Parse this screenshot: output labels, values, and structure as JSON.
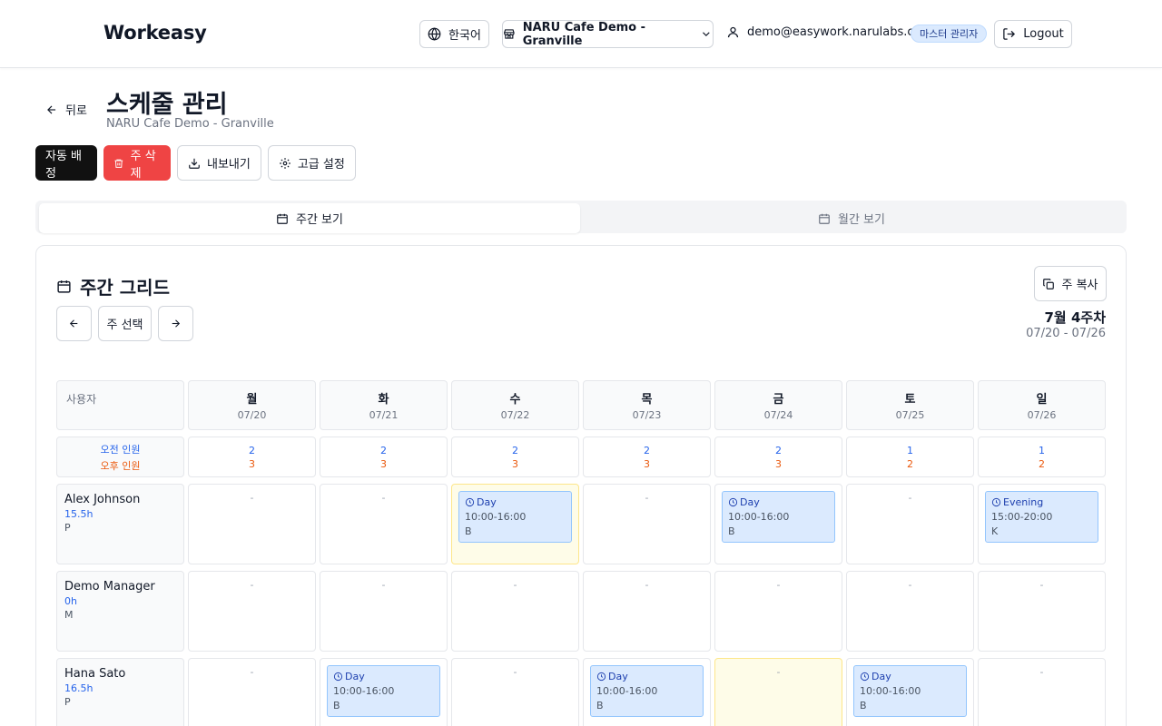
{
  "header": {
    "brand": "Workeasy",
    "language": "한국어",
    "store": "NARU Cafe Demo - Granville",
    "email": "demo@easywork.narulabs.ca",
    "role_badge": "마스터 관리자",
    "logout": "Logout"
  },
  "page": {
    "back": "뒤로",
    "title": "스케줄 관리",
    "subtitle": "NARU Cafe Demo - Granville"
  },
  "actions": {
    "auto_assign": "자동 배정",
    "delete_week": "주 삭제",
    "export": "내보내기",
    "advanced": "고급 설정"
  },
  "tabs": {
    "weekly": "주간 보기",
    "monthly": "월간 보기"
  },
  "card": {
    "title": "주간 그리드",
    "copy_week": "주 복사",
    "select_week": "주 선택",
    "week_label": "7월 4주차",
    "week_range": "07/20 - 07/26"
  },
  "grid": {
    "user_header": "사용자",
    "am_label": "오전 인원",
    "pm_label": "오후 인원",
    "days": [
      {
        "name": "월",
        "date": "07/20",
        "am": "2",
        "pm": "3"
      },
      {
        "name": "화",
        "date": "07/21",
        "am": "2",
        "pm": "3"
      },
      {
        "name": "수",
        "date": "07/22",
        "am": "2",
        "pm": "3"
      },
      {
        "name": "목",
        "date": "07/23",
        "am": "2",
        "pm": "3"
      },
      {
        "name": "금",
        "date": "07/24",
        "am": "2",
        "pm": "3"
      },
      {
        "name": "토",
        "date": "07/25",
        "am": "1",
        "pm": "2"
      },
      {
        "name": "일",
        "date": "07/26",
        "am": "1",
        "pm": "2"
      }
    ],
    "empty": "-",
    "users": [
      {
        "name": "Alex Johnson",
        "hours": "15.5h",
        "role": "P",
        "cells": [
          {
            "hl": false
          },
          {
            "hl": false
          },
          {
            "hl": true,
            "shift": {
              "name": "Day",
              "time": "10:00-16:00",
              "pos": "B"
            }
          },
          {
            "hl": false
          },
          {
            "hl": false,
            "shift": {
              "name": "Day",
              "time": "10:00-16:00",
              "pos": "B"
            }
          },
          {
            "hl": false
          },
          {
            "hl": false,
            "shift": {
              "name": "Evening",
              "time": "15:00-20:00",
              "pos": "K"
            }
          }
        ]
      },
      {
        "name": "Demo Manager",
        "hours": "0h",
        "role": "M",
        "cells": [
          {
            "hl": false
          },
          {
            "hl": false
          },
          {
            "hl": false
          },
          {
            "hl": false
          },
          {
            "hl": false
          },
          {
            "hl": false
          },
          {
            "hl": false
          }
        ]
      },
      {
        "name": "Hana Sato",
        "hours": "16.5h",
        "role": "P",
        "cells": [
          {
            "hl": false
          },
          {
            "hl": false,
            "shift": {
              "name": "Day",
              "time": "10:00-16:00",
              "pos": "B"
            }
          },
          {
            "hl": false
          },
          {
            "hl": false,
            "shift": {
              "name": "Day",
              "time": "10:00-16:00",
              "pos": "B"
            }
          },
          {
            "hl": true
          },
          {
            "hl": false,
            "shift": {
              "name": "Day",
              "time": "10:00-16:00",
              "pos": "B"
            }
          },
          {
            "hl": false
          }
        ]
      }
    ]
  }
}
